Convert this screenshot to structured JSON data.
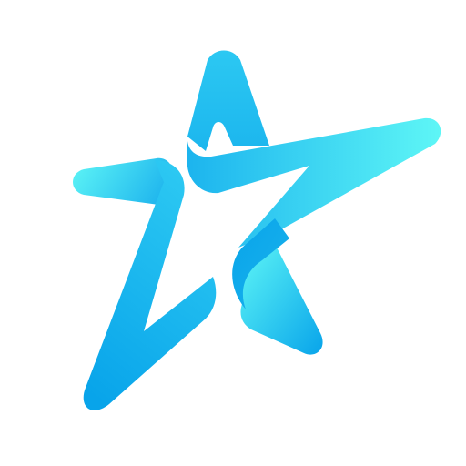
{
  "logo": {
    "icon": "ribbon-star-icon",
    "colors": {
      "background": "#ffffff",
      "cyan_light": "#5ef6f6",
      "blue_mid": "#2cc8f2",
      "blue_deep": "#08a4ea"
    }
  }
}
